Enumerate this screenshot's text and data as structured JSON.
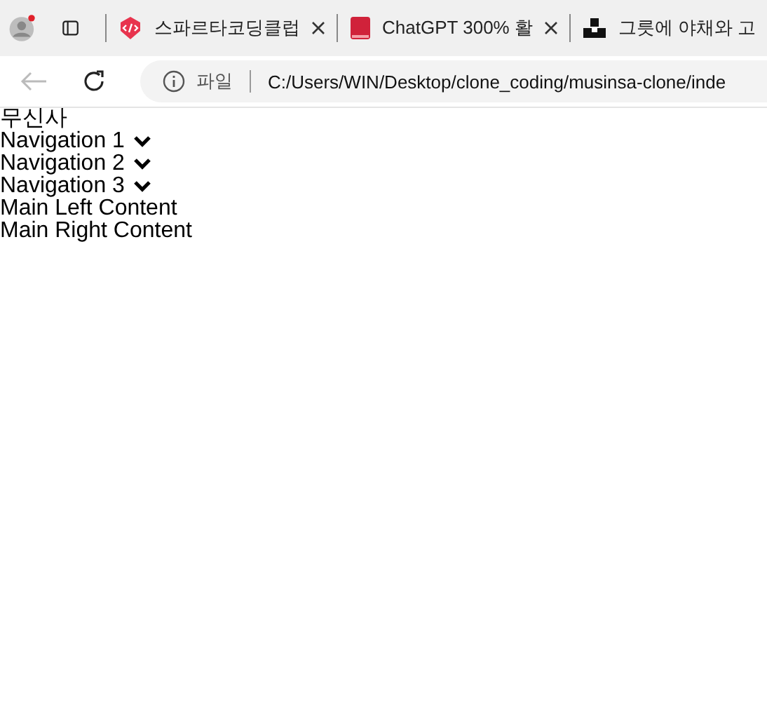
{
  "tabs": [
    {
      "title": "스파르타코딩클럽",
      "kind": "code",
      "selected": false
    },
    {
      "title": "ChatGPT 300% 활",
      "kind": "book",
      "selected": false
    },
    {
      "title": "그릇에 야채와 고",
      "kind": "blocks",
      "selected": false
    }
  ],
  "address_bar": {
    "scheme_label": "파일",
    "url": "C:/Users/WIN/Desktop/clone_coding/musinsa-clone/inde"
  },
  "page": {
    "logo": "무신사",
    "navigation": [
      {
        "label": "Navigation 1"
      },
      {
        "label": "Navigation 2"
      },
      {
        "label": "Navigation 3"
      }
    ],
    "content": [
      "Main Left Content",
      "Main Right Content"
    ]
  }
}
